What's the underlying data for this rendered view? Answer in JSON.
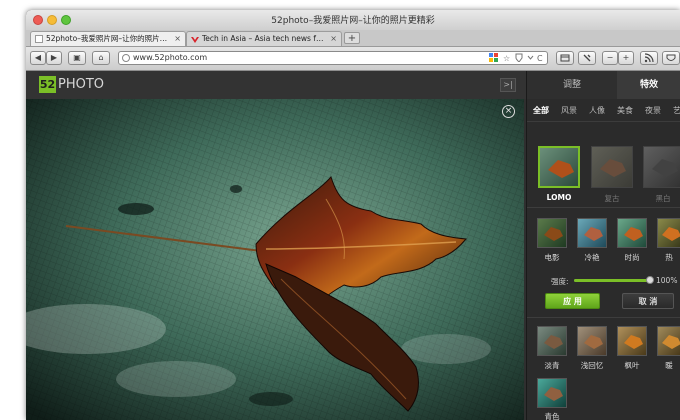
{
  "window": {
    "title": "52photo–我爱照片网–让你的照片更精彩"
  },
  "tabs": [
    {
      "label": "52photo–我爱照片网–让你的照片…",
      "close": "×"
    },
    {
      "label": "Tech in Asia – Asia tech news f…",
      "close": "×"
    }
  ],
  "new_tab": "+",
  "nav": {
    "back": "◀",
    "forward": "▶",
    "view": "▣",
    "home": "⌂"
  },
  "address": {
    "url": "www.52photo.com",
    "star": "☆",
    "reload": "C"
  },
  "toolbar_right": {
    "zoom_out": "−",
    "zoom_in": "+"
  },
  "app": {
    "logo_badge": "52",
    "logo_word": "PHOTO",
    "collapse": ">|",
    "photo_close": "×"
  },
  "panel": {
    "tabs": [
      "调整",
      "特效"
    ],
    "categories": [
      "全部",
      "风景",
      "人像",
      "美食",
      "夜景",
      "艺"
    ],
    "featured": [
      {
        "label": "LOMO",
        "selected": true
      },
      {
        "label": "复古",
        "selected": false
      },
      {
        "label": "黑白",
        "selected": false
      }
    ],
    "row1": [
      "电影",
      "冷艳",
      "时尚",
      "热"
    ],
    "strength_label": "强度:",
    "strength_value": "100%",
    "strength": 1.0,
    "apply": "应 用",
    "cancel": "取 消",
    "row2": [
      "淡青",
      "浅回忆",
      "枫叶",
      "暖"
    ],
    "row3": [
      "青色"
    ]
  },
  "colors": {
    "accent": "#7bbf27",
    "panel_bg": "#2b2b2b"
  }
}
